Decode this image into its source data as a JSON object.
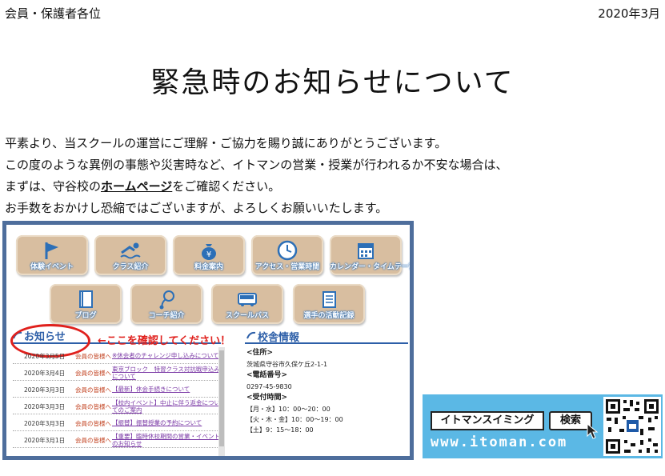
{
  "header": {
    "addressee": "会員・保護者各位",
    "date": "2020年3月"
  },
  "title": "緊急時のお知らせについて",
  "body": {
    "line1": "平素より、当スクールの運営にご理解・ご協力を賜り誠にありがとうございます。",
    "line2": "この度のような異例の事態や災害時など、イトマンの営業・授業が行われるか不安な場合は、",
    "line3_pre": "まずは、守谷校の",
    "line3_link": "ホームページ",
    "line3_post": "をご確認ください。",
    "line4": "お手数をおかけし恐縮ではございますが、よろしくお願いいたします。"
  },
  "website": {
    "nav_row1": [
      {
        "label": "体験イベント",
        "icon": "flag-icon"
      },
      {
        "label": "クラス紹介",
        "icon": "swimmer-icon"
      },
      {
        "label": "料金案内",
        "icon": "money-bag-icon"
      },
      {
        "label": "アクセス・営業時間",
        "icon": "clock-icon"
      },
      {
        "label": "カレンダー・タイムテーブル",
        "icon": "calendar-icon"
      }
    ],
    "nav_row2": [
      {
        "label": "ブログ",
        "icon": "notebook-icon"
      },
      {
        "label": "コーチ紹介",
        "icon": "whistle-icon"
      },
      {
        "label": "スクールバス",
        "icon": "bus-icon"
      },
      {
        "label": "選手の活動記録",
        "icon": "memo-icon"
      }
    ],
    "news_heading": "お知らせ",
    "check_note": "←ここを確認してください！",
    "news": [
      {
        "date": "2020年3月5日",
        "member": "会員の皆様へ",
        "text": "※休会者のチャレンジ申し込みについて"
      },
      {
        "date": "2020年3月4日",
        "member": "会員の皆様へ",
        "text": "東京ブロック　特習クラス対抗戦申込みについて"
      },
      {
        "date": "2020年3月3日",
        "member": "会員の皆様へ",
        "text": "【最新】休会手続きについて"
      },
      {
        "date": "2020年3月3日",
        "member": "会員の皆様へ",
        "text": "【校内イベント】中止に伴う返金についてのご案内"
      },
      {
        "date": "2020年3月3日",
        "member": "会員の皆様へ",
        "text": "【振替】振替授業の予約について"
      },
      {
        "date": "2020年3月1日",
        "member": "会員の皆様へ",
        "text": "【重要】臨時休校期間の営業・イベントのお知らせ"
      }
    ],
    "info_heading": "校舎情報",
    "address_label": "<住所>",
    "address": "茨城県守谷市久保ケ丘2-1-1",
    "phone_label": "<電話番号>",
    "phone": "0297-45-9830",
    "hours_label": "<受付時間>",
    "hours": [
      "【月・水】10：00〜20：00",
      "【火・木・金】10：00〜19：00",
      "【土】9：15〜18：00"
    ]
  },
  "banner": {
    "name": "イトマンスイミング",
    "search": "検索",
    "url": "www.itoman.com"
  },
  "colors": {
    "frame": "#4e6e9c",
    "accent_blue": "#2d5fa8",
    "alert_red": "#e0201c",
    "banner_bg": "#5bb8e5"
  }
}
